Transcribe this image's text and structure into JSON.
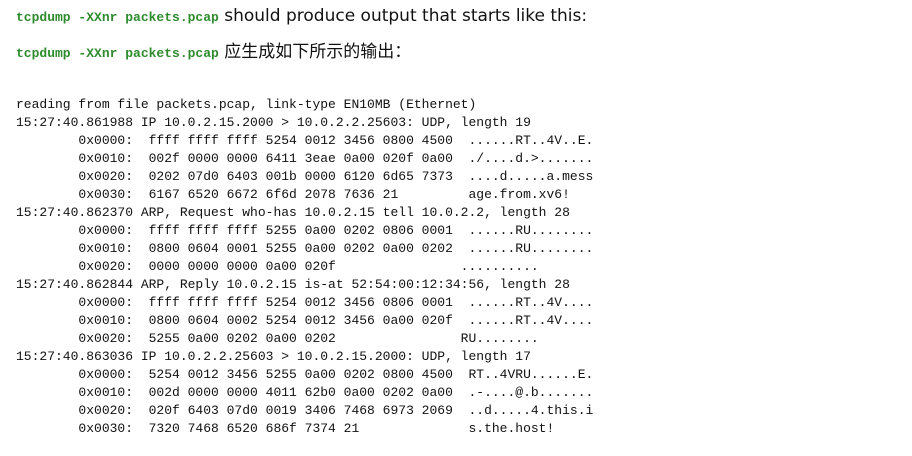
{
  "header": {
    "line1": {
      "command": "tcpdump -XXnr packets.pcap",
      "text": " should produce output that starts like this:"
    },
    "line2": {
      "command": "tcpdump -XXnr packets.pcap",
      "text": " 应生成如下所示的输出："
    },
    "colors": {
      "command": "#2e8b2e",
      "text": "#111111"
    }
  },
  "output": {
    "lines": [
      "reading from file packets.pcap, link-type EN10MB (Ethernet)",
      "15:27:40.861988 IP 10.0.2.15.2000 > 10.0.2.2.25603: UDP, length 19",
      "        0x0000:  ffff ffff ffff 5254 0012 3456 0800 4500  ......RT..4V..E.",
      "        0x0010:  002f 0000 0000 6411 3eae 0a00 020f 0a00  ./....d.>.......",
      "        0x0020:  0202 07d0 6403 001b 0000 6120 6d65 7373  ....d.....a.mess",
      "        0x0030:  6167 6520 6672 6f6d 2078 7636 21         age.from.xv6!",
      "15:27:40.862370 ARP, Request who-has 10.0.2.15 tell 10.0.2.2, length 28",
      "        0x0000:  ffff ffff ffff 5255 0a00 0202 0806 0001  ......RU........",
      "        0x0010:  0800 0604 0001 5255 0a00 0202 0a00 0202  ......RU........",
      "        0x0020:  0000 0000 0000 0a00 020f                ..........",
      "15:27:40.862844 ARP, Reply 10.0.2.15 is-at 52:54:00:12:34:56, length 28",
      "        0x0000:  ffff ffff ffff 5254 0012 3456 0806 0001  ......RT..4V....",
      "        0x0010:  0800 0604 0002 5254 0012 3456 0a00 020f  ......RT..4V....",
      "        0x0020:  5255 0a00 0202 0a00 0202                RU........",
      "15:27:40.863036 IP 10.0.2.2.25603 > 10.0.2.15.2000: UDP, length 17",
      "        0x0000:  5254 0012 3456 5255 0a00 0202 0800 4500  RT..4VRU......E.",
      "        0x0010:  002d 0000 0000 4011 62b0 0a00 0202 0a00  .-....@.b.......",
      "        0x0020:  020f 6403 07d0 0019 3406 7468 6973 2069  ..d.....4.this.i",
      "        0x0030:  7320 7468 6520 686f 7374 21              s.the.host!"
    ]
  }
}
